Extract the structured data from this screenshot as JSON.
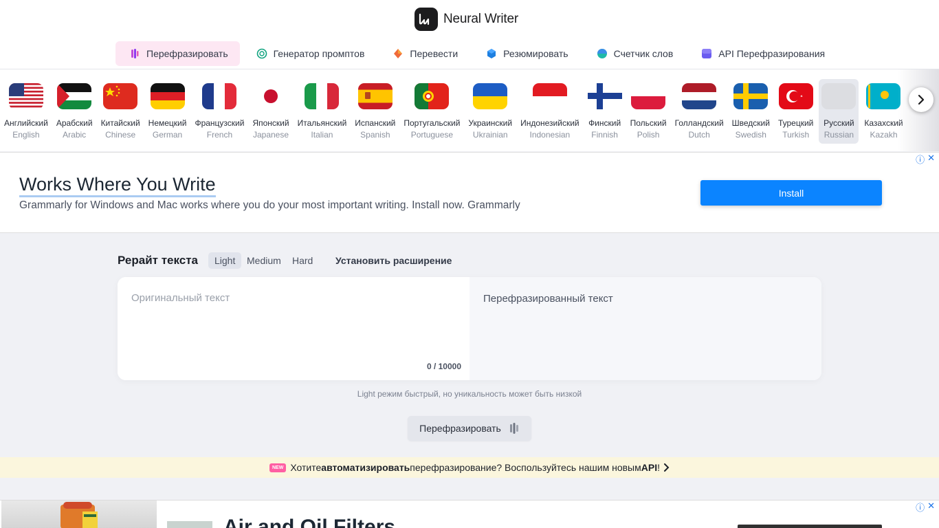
{
  "app": {
    "name": "Neural Writer"
  },
  "nav": [
    {
      "label": "Перефразировать",
      "icon": "paraphrase-icon",
      "active": true
    },
    {
      "label": "Генератор промптов",
      "icon": "prompt-generator-icon"
    },
    {
      "label": "Перевести",
      "icon": "translate-icon"
    },
    {
      "label": "Резюмировать",
      "icon": "summarize-icon"
    },
    {
      "label": "Счетчик слов",
      "icon": "word-counter-icon"
    },
    {
      "label": "API Перефразирования",
      "icon": "api-icon"
    }
  ],
  "languages": [
    {
      "native": "Английский",
      "en": "English",
      "flag": "us"
    },
    {
      "native": "Арабский",
      "en": "Arabic",
      "flag": "ps"
    },
    {
      "native": "Китайский",
      "en": "Chinese",
      "flag": "cn"
    },
    {
      "native": "Немецкий",
      "en": "German",
      "flag": "de"
    },
    {
      "native": "Французский",
      "en": "French",
      "flag": "fr"
    },
    {
      "native": "Японский",
      "en": "Japanese",
      "flag": "jp"
    },
    {
      "native": "Итальянский",
      "en": "Italian",
      "flag": "it"
    },
    {
      "native": "Испанский",
      "en": "Spanish",
      "flag": "es"
    },
    {
      "native": "Португальский",
      "en": "Portuguese",
      "flag": "pt"
    },
    {
      "native": "Украинский",
      "en": "Ukrainian",
      "flag": "ua"
    },
    {
      "native": "Индонезийский",
      "en": "Indonesian",
      "flag": "id"
    },
    {
      "native": "Финский",
      "en": "Finnish",
      "flag": "fi"
    },
    {
      "native": "Польский",
      "en": "Polish",
      "flag": "pl"
    },
    {
      "native": "Голландский",
      "en": "Dutch",
      "flag": "nl"
    },
    {
      "native": "Шведский",
      "en": "Swedish",
      "flag": "se"
    },
    {
      "native": "Турецкий",
      "en": "Turkish",
      "flag": "tr"
    },
    {
      "native": "Русский",
      "en": "Russian",
      "flag": "ru",
      "active": true
    },
    {
      "native": "Казахский",
      "en": "Kazakh",
      "flag": "kz"
    }
  ],
  "ad": {
    "title": "Works Where You Write",
    "description": "Grammarly for Windows and Mac works where you do your most important writing. Install now. Grammarly",
    "button": "Install"
  },
  "rewrite": {
    "title": "Рерайт текста",
    "modes": [
      "Light",
      "Medium",
      "Hard"
    ],
    "active_mode": "Light",
    "install_extension": "Установить расширение",
    "input_placeholder": "Оригинальный текст",
    "counter": "0 / 10000",
    "output_placeholder": "Перефразированный текст",
    "hint": "Light режим быстрый, но уникальность может быть низкой",
    "button": "Перефразировать"
  },
  "promo": {
    "badge": "NEW",
    "text_before": "Хотите ",
    "text_bold": "автоматизировать",
    "text_middle": " перефразирование? Воспользуйтесь нашим новым ",
    "text_api": "API",
    "text_end": "!"
  },
  "ad2": {
    "title": "Air and Oil Filters"
  }
}
